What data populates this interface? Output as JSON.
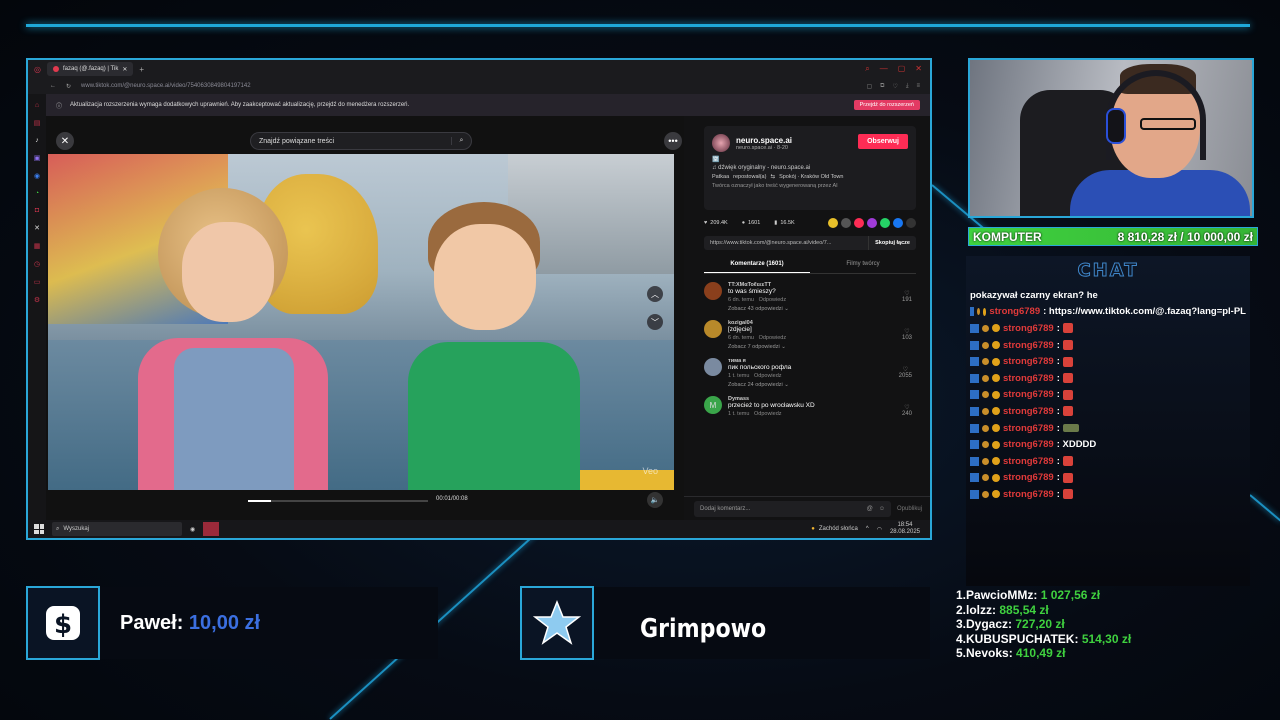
{
  "browser": {
    "tab_title": "fazaq (@.fazaq) | Tik",
    "url": "www.tiktok.com/@neuro.space.ai/video/754063084980419714​2",
    "notice_text": "Aktualizacja rozszerzenia wymaga dodatkowych uprawnień. Aby zaakceptować aktualizację, przejdź do menedżera rozszerzeń.",
    "notice_button": "Przejdź do rozszerzeń"
  },
  "tiktok": {
    "search_placeholder": "Znajdź powiązane treści",
    "progress": 0.125,
    "time": "00:01/00:08",
    "author": {
      "name": "neuro.space.ai",
      "sub": "neuro.space.ai · 8-20",
      "follow_label": "Obserwuj",
      "caption_glyph": "🈳",
      "sound": "♫ dźwięk oryginalny - neuro.space.ai",
      "repost_by": "Patkaa",
      "repost_text": "repostował(a)",
      "location": "Spokój · Kraków Old Town",
      "ai_notice": "Twórca oznaczył jako treść wygenerowaną przez AI"
    },
    "stats": {
      "likes": "209.4K",
      "comments": "1601",
      "saves": "16.5K"
    },
    "link": "https://www.tiktok.com/@neuro.space.ai/video/7...",
    "copy_label": "Skopiuj łącze",
    "tabs": [
      "Komentarze (1601)",
      "Filmy twórcy"
    ],
    "comments": [
      {
        "user": "ΤΤ:ΧΜαΤοℓεεεΤΤ",
        "text": "to was śmieszy?",
        "date": "6 dn. temu",
        "reply": "Odpowiedz",
        "more": "Zobacz 43 odpowiedzi ⌄",
        "likes": "191",
        "color": "#8a3f1c"
      },
      {
        "user": "kozigal04",
        "text": "[zdjęcie]",
        "date": "6 dn. temu",
        "reply": "Odpowiedz",
        "more": "Zobacz 7 odpowiedzi ⌄",
        "likes": "103",
        "color": "#b8892a"
      },
      {
        "user": "тима я",
        "text": "пик польского рофла",
        "date": "1 t. temu",
        "reply": "Odpowiedz",
        "more": "Zobacz 24 odpowiedzi ⌄",
        "likes": "2055",
        "color": "#7a8aa0"
      },
      {
        "user": "Dymass",
        "text": "przecież to po wrocławsku XD",
        "date": "1 t. temu",
        "reply": "Odpowiedz",
        "more": "",
        "likes": "240",
        "color": "#3aa54a",
        "letter": "M"
      }
    ],
    "comment_placeholder": "Dodaj komentarz...",
    "post_label": "Opublikuj",
    "watermark": "Veo"
  },
  "taskbar": {
    "search": "Wyszukaj",
    "weather": "Zachód słońca",
    "time": "18:54",
    "date": "28.08.2025"
  },
  "goal": {
    "label": "KOMPUTER",
    "amount": "8 810,28 zł / 10 000,00 zł",
    "progress": 0.881
  },
  "chat": {
    "title": "CHAT",
    "first_line": "pokazywał czarny ekran? he",
    "messages": [
      {
        "user": "strong6789",
        "text": ": https://www.tiktok.com/@.fazaq?lang=pl-PL",
        "emote": ""
      },
      {
        "user": "strong6789",
        "text": ":",
        "emote": "red"
      },
      {
        "user": "strong6789",
        "text": ":",
        "emote": "red"
      },
      {
        "user": "strong6789",
        "text": ":",
        "emote": "red"
      },
      {
        "user": "strong6789",
        "text": ":",
        "emote": "red"
      },
      {
        "user": "strong6789",
        "text": ":",
        "emote": "red"
      },
      {
        "user": "strong6789",
        "text": ":",
        "emote": "red"
      },
      {
        "user": "strong6789",
        "text": ":",
        "emote": "tank"
      },
      {
        "user": "strong6789",
        "text": ": XDDDD",
        "emote": ""
      },
      {
        "user": "strong6789",
        "text": ":",
        "emote": "red"
      },
      {
        "user": "strong6789",
        "text": ":",
        "emote": "red"
      },
      {
        "user": "strong6789",
        "text": ":",
        "emote": "red"
      }
    ]
  },
  "donation": {
    "name": "Paweł:",
    "amount": "10,00 zł"
  },
  "follower": {
    "name": "Grimpowo"
  },
  "leaderboard": [
    {
      "rank": "1.",
      "name": "PawcioMMz:",
      "amount": "1 027,56 zł"
    },
    {
      "rank": "2.",
      "name": "lolzz:",
      "amount": "885,54 zł"
    },
    {
      "rank": "3.",
      "name": "Dygacz:",
      "amount": "727,20 zł"
    },
    {
      "rank": "4.",
      "name": "KUBUSPUCHATEK:",
      "amount": "514,30 zł"
    },
    {
      "rank": "5.",
      "name": "Nevoks:",
      "amount": "410,49 zł"
    }
  ]
}
